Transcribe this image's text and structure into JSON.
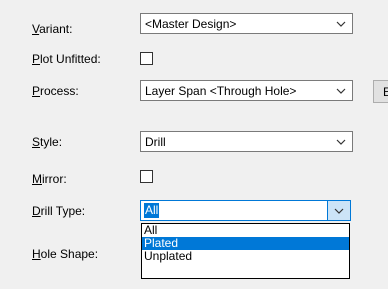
{
  "fields": {
    "variant": {
      "label_key": "V",
      "label_rest": "ariant:",
      "value": "<Master Design>"
    },
    "plot_unfitted": {
      "label_key": "P",
      "label_rest": "lot Unfitted:",
      "checked": false
    },
    "process": {
      "label_key": "P",
      "label_rest": "rocess:",
      "value": "Layer Span <Through Hole>"
    },
    "style": {
      "label_key": "S",
      "label_rest": "tyle:",
      "value": "Drill"
    },
    "mirror": {
      "label_key": "M",
      "label_rest": "irror:",
      "checked": false
    },
    "drill_type": {
      "label_key": "D",
      "label_rest": "rill Type:",
      "value": "All"
    },
    "hole_shape": {
      "label_key": "H",
      "label_rest": "ole Shape:"
    }
  },
  "side_button_label": "E",
  "dropdown": {
    "options": [
      "All",
      "Plated",
      "Unplated"
    ],
    "highlighted": "Plated"
  },
  "colors": {
    "accent": "#0078d7",
    "dialog_bg": "#f0f0f0"
  }
}
